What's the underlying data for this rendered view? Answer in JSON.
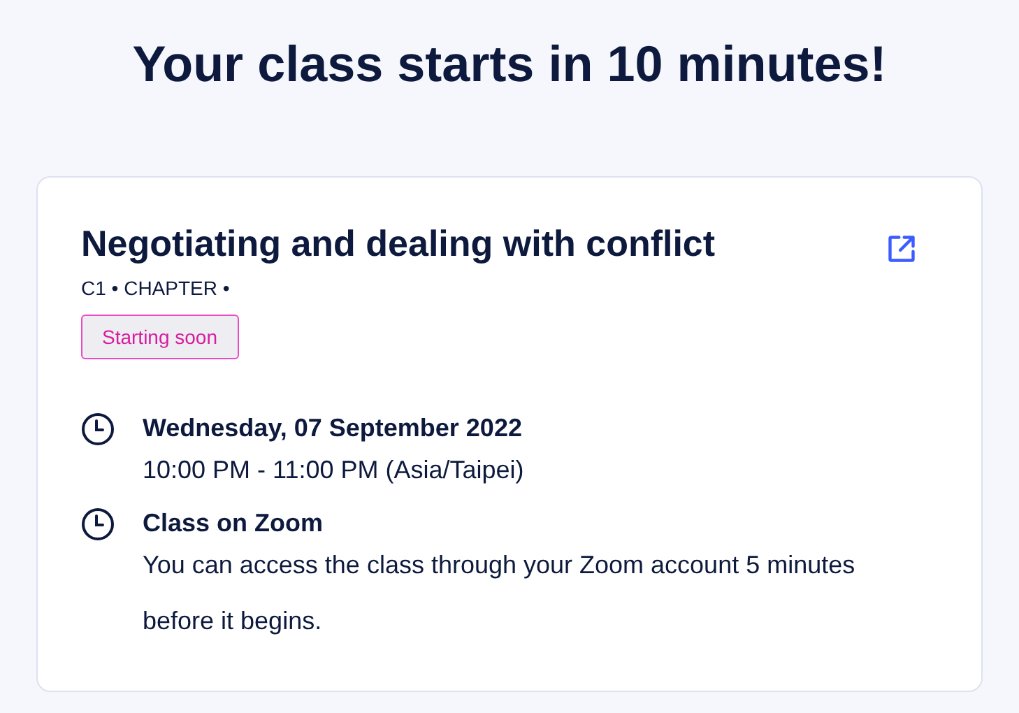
{
  "heading": "Your class starts in 10 minutes!",
  "card": {
    "title": "Negotiating and dealing with conflict",
    "meta": "C1 • CHAPTER •",
    "badge": "Starting soon",
    "details": [
      {
        "heading": "Wednesday, 07 September 2022",
        "text": "10:00 PM - 11:00 PM (Asia/Taipei)"
      },
      {
        "heading": "Class on Zoom",
        "text": "You can access the class through your Zoom account 5 minutes before it begins."
      }
    ]
  }
}
